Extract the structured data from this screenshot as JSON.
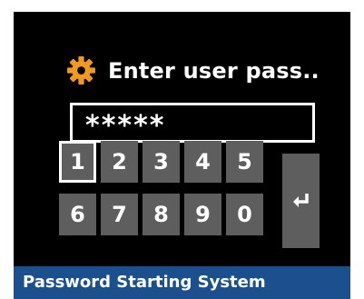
{
  "header": {
    "icon": "gear-icon",
    "title": "Enter user pass..",
    "accent_color": "#f29a1d"
  },
  "password_field": {
    "value": "*****"
  },
  "keypad": {
    "keys": [
      "1",
      "2",
      "3",
      "4",
      "5",
      "6",
      "7",
      "8",
      "9",
      "0"
    ],
    "selected_key": "1",
    "enter_icon": "enter-return-icon"
  },
  "footer": {
    "label": "Password Starting System",
    "color": "#1b4f8e"
  }
}
